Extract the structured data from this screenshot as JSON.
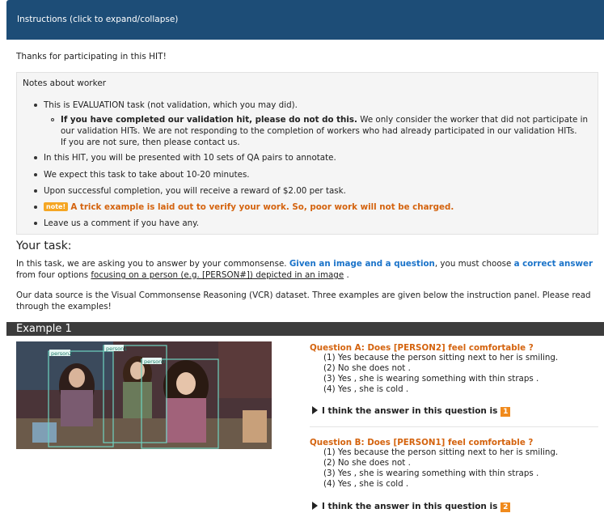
{
  "header": {
    "title": "Instructions (click to expand/collapse)"
  },
  "thanks": "Thanks for participating in this HIT!",
  "notes": {
    "heading": "Notes about worker",
    "items": [
      "This is EVALUATION task (not validation, which you may did).",
      "In this HIT, you will be presented with 10 sets of QA pairs to annotate.",
      "We expect this task to take about 10-20 minutes.",
      "Upon successful completion, you will receive a reward of $2.00 per task.",
      "A trick example is laid out to verify your work. So, poor work will not be charged.",
      "Leave us a comment if you have any."
    ],
    "sub_bold": "If you have completed our validation hit, please do not do this.",
    "sub_line1": "We only consider the worker that did not participate in",
    "sub_line2": "our validation HITs. We are not responding to the completion of workers who had already participated in our validation HITs.",
    "sub_line3": "If you are not sure, then please contact us.",
    "note_badge": "note!"
  },
  "task": {
    "title": "Your task:",
    "p1_a": "In this task, we are asking you to answer by your commonsense.",
    "p1_b": "Given an image and a question",
    "p1_c": ", you must choose",
    "p1_d": "a correct answer",
    "p1_e": "from four options",
    "p1_f": "focusing on a person (e.g. [PERSON#]) depicted in an image",
    "p1_g": ".",
    "p2_line1": "Our data source is the Visual Commonsense Reasoning (VCR) dataset. Three examples are given below the instruction panel. Please read",
    "p2_line2": "through the examples!"
  },
  "example": {
    "title": "Example 1",
    "image_labels": [
      "person2",
      "person1",
      "person0"
    ],
    "questions": [
      {
        "title": "Question A: Does [PERSON2] feel comfortable ?",
        "options": [
          "(1) Yes because the person sitting next to her is smiling.",
          "(2) No she does not .",
          "(3) Yes , she is wearing something with thin straps .",
          "(4) Yes , she is cold ."
        ],
        "answer_text": "I think the answer in this question is",
        "answer": "1"
      },
      {
        "title": "Question B: Does [PERSON1] feel comfortable ?",
        "options": [
          "(1) Yes because the person sitting next to her is smiling.",
          "(2) No she does not .",
          "(3) Yes , she is wearing something with thin straps .",
          "(4) Yes , she is cold ."
        ],
        "answer_text": "I think the answer in this question is",
        "answer": "2"
      }
    ]
  }
}
